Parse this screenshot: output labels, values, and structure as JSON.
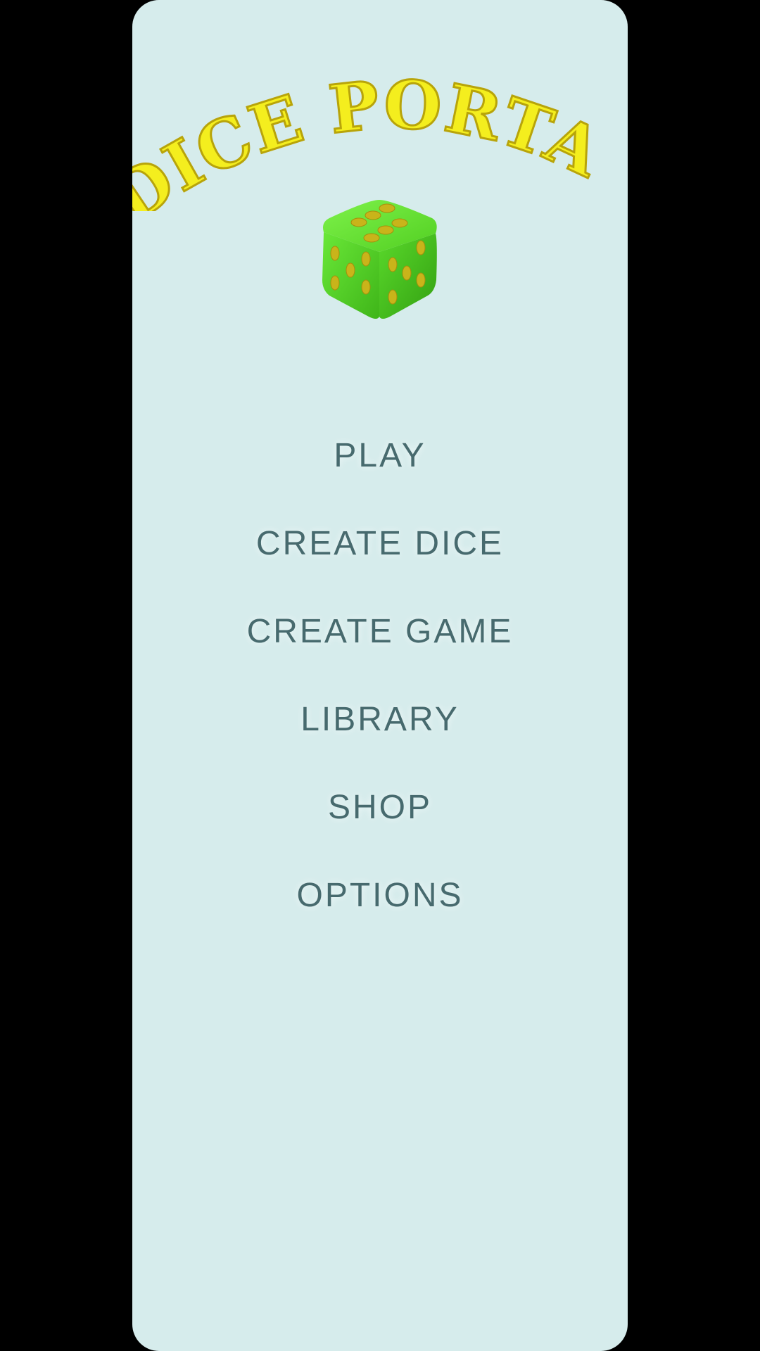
{
  "app": {
    "title": "DICE PORTAL"
  },
  "menu": {
    "items": [
      {
        "label": "PLAY"
      },
      {
        "label": "CREATE DICE"
      },
      {
        "label": "CREATE GAME"
      },
      {
        "label": "LIBRARY"
      },
      {
        "label": "SHOP"
      },
      {
        "label": "OPTIONS"
      }
    ]
  },
  "colors": {
    "background": "#000000",
    "panel": "#d6ecec",
    "title_gold": "#f4ee1e",
    "menu_text": "#476a6e",
    "die_green": "#5fe02e",
    "pip_gold": "#c9b41a"
  },
  "icons": {
    "logo_die": "die-icon"
  }
}
